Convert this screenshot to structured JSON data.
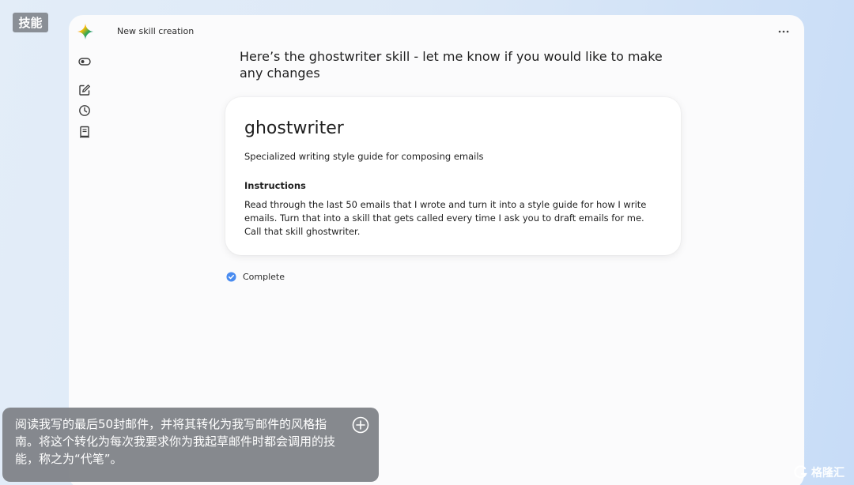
{
  "corner_tag": "技能",
  "window": {
    "title": "New skill creation",
    "more_icon": "more-horizontal-icon"
  },
  "rail": {
    "icons": [
      "toggle-icon",
      "edit-icon",
      "history-icon",
      "document-icon"
    ]
  },
  "chat": {
    "heading": "Here’s the ghostwriter skill - let me know if you would like to make any changes",
    "status_label": "Complete"
  },
  "skill": {
    "name": "ghostwriter",
    "description": "Specialized writing style guide for composing emails",
    "instructions_label": "Instructions",
    "instructions": "Read through the last 50 emails that I wrote and turn it into a style guide for how I write emails. Turn that into a skill that gets called every time I ask you to draft emails for me. Call that skill ghostwriter."
  },
  "subtitle": {
    "text": "阅读我写的最后50封邮件，并将其转化为我写邮件的风格指南。将这个转化为每次我要求你为我起草邮件时都会调用的技能，称之为“代笔”。"
  },
  "watermark": {
    "text": "格隆汇"
  },
  "colors": {
    "check": "#4a8cf0",
    "gem_blue": "#4285f4",
    "gem_red": "#ea4335",
    "gem_yellow": "#fbbc04",
    "gem_green": "#34a853"
  }
}
